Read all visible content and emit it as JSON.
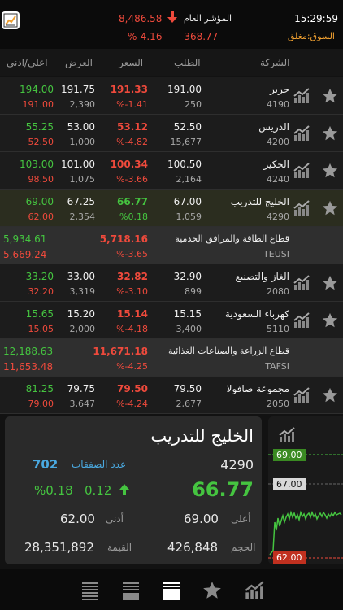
{
  "header": {
    "time": "15:29:59",
    "market_status": "السوق:مغلق",
    "index_label": "المؤشر العام",
    "index_value": "8,486.58",
    "index_change": "-368.77",
    "index_change_pct": "%-4.16"
  },
  "columns": {
    "company": "الشركة",
    "bid": "الطلب",
    "price": "السعر",
    "ask": "العرض",
    "high_low": "اعلى/ادنى"
  },
  "rows": [
    {
      "name": "جرير",
      "code": "4190",
      "bid": "191.00",
      "bid_qty": "250",
      "price": "191.33",
      "change_pct": "%-1.41",
      "ask": "191.75",
      "ask_qty": "2,390",
      "high": "194.00",
      "low": "191.00"
    },
    {
      "name": "الدريس",
      "code": "4200",
      "bid": "52.50",
      "bid_qty": "15,677",
      "price": "53.12",
      "change_pct": "%-4.82",
      "ask": "53.00",
      "ask_qty": "1,000",
      "high": "55.25",
      "low": "52.50"
    },
    {
      "name": "الحكير",
      "code": "4240",
      "bid": "100.50",
      "bid_qty": "2,164",
      "price": "100.34",
      "change_pct": "%-3.66",
      "ask": "101.00",
      "ask_qty": "1,075",
      "high": "103.00",
      "low": "98.50"
    },
    {
      "name": "الخليج للتدريب",
      "code": "4290",
      "bid": "67.00",
      "bid_qty": "1,059",
      "price": "66.77",
      "change_pct": "%0.18",
      "ask": "67.25",
      "ask_qty": "2,354",
      "high": "69.00",
      "low": "62.00"
    },
    {
      "name": "الغاز والتصنيع",
      "code": "2080",
      "bid": "32.90",
      "bid_qty": "899",
      "price": "32.82",
      "change_pct": "%-3.10",
      "ask": "33.00",
      "ask_qty": "3,319",
      "high": "33.20",
      "low": "32.20"
    },
    {
      "name": "كهرباء السعودية",
      "code": "5110",
      "bid": "15.15",
      "bid_qty": "3,400",
      "price": "15.14",
      "change_pct": "%-4.18",
      "ask": "15.20",
      "ask_qty": "2,000",
      "high": "15.65",
      "low": "15.05"
    },
    {
      "name": "مجموعة صافولا",
      "code": "2050",
      "bid": "79.50",
      "bid_qty": "2,677",
      "price": "79.50",
      "change_pct": "%-4.24",
      "ask": "79.75",
      "ask_qty": "3,647",
      "high": "81.25",
      "low": "79.00"
    }
  ],
  "sectors": [
    {
      "name": "قطاع الطاقة والمرافق الخدمية",
      "code": "TEUSI",
      "price": "5,718.16",
      "change_pct": "%-3.65",
      "high": "5,934.61",
      "low": "5,669.24"
    },
    {
      "name": "قطاع الزراعة والصناعات الغذائية",
      "code": "TAFSI",
      "price": "11,671.18",
      "change_pct": "%-4.25",
      "high": "12,188.63",
      "low": "11,653.48"
    }
  ],
  "detail": {
    "name": "الخليج للتدريب",
    "code": "4290",
    "price": "66.77",
    "change": "0.12",
    "change_pct": "%0.18",
    "trades_label": "عدد الصفقات",
    "trades": "702",
    "high_label": "أعلى",
    "high": "69.00",
    "low_label": "أدنى",
    "low": "62.00",
    "volume_label": "الحجم",
    "volume": "426,848",
    "value_label": "القيمة",
    "value": "28,351,892"
  },
  "mini_chart": {
    "high_tag": "69.00",
    "mid_tag": "67.00",
    "low_tag": "62.00"
  },
  "colors": {
    "up": "#45c440",
    "down": "#ef4a3c",
    "accent_blue": "#4aa9e0",
    "market_status": "#f0a030"
  },
  "tabs": [
    "list-icon",
    "list-detail-icon",
    "watchlist-icon",
    "favorites-star-icon",
    "chart-icon"
  ]
}
